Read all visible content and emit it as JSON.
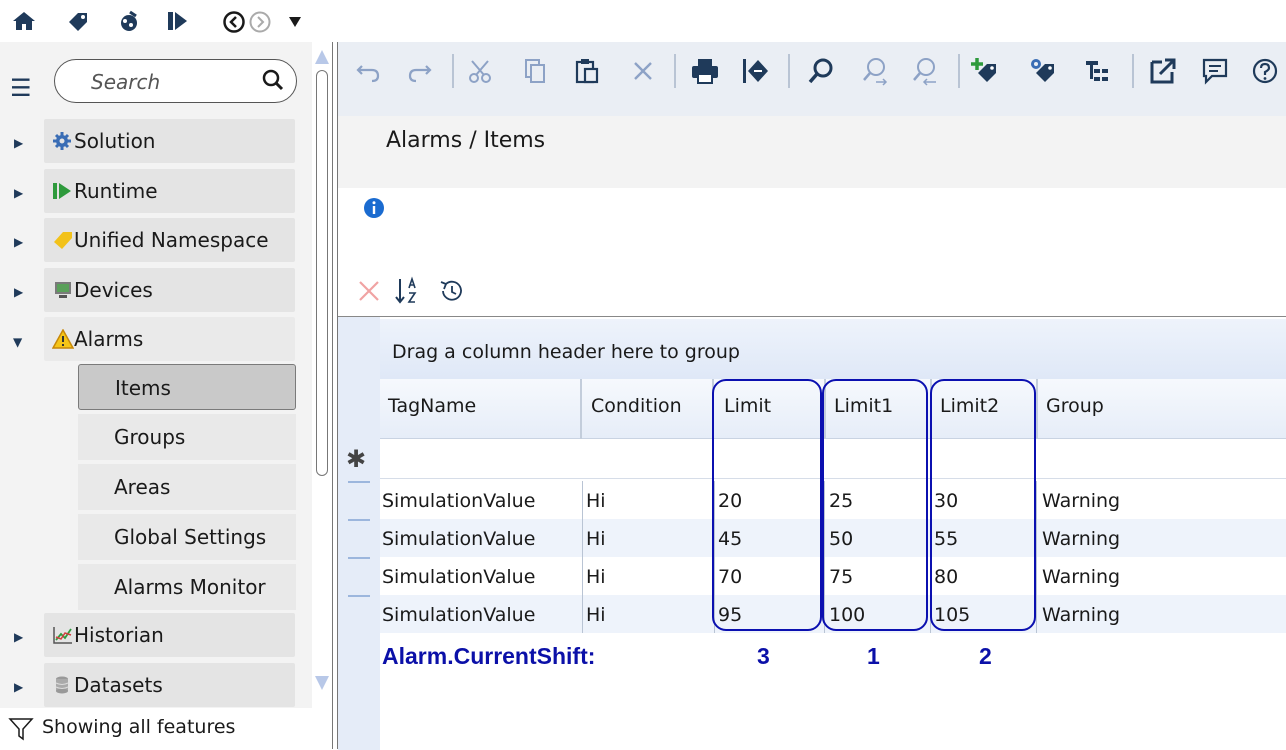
{
  "sidebar": {
    "search_placeholder": "Search",
    "items": [
      {
        "label": "Solution",
        "icon": "gear-icon"
      },
      {
        "label": "Runtime",
        "icon": "runtime-icon"
      },
      {
        "label": "Unified Namespace",
        "icon": "tag-icon"
      },
      {
        "label": "Devices",
        "icon": "devices-icon"
      },
      {
        "label": "Alarms",
        "icon": "warning-icon"
      },
      {
        "label": "Historian",
        "icon": "chart-icon"
      },
      {
        "label": "Datasets",
        "icon": "database-icon"
      }
    ],
    "alarm_children": [
      "Items",
      "Groups",
      "Areas",
      "Global Settings",
      "Alarms Monitor"
    ],
    "selected": "Items",
    "filter_text": "Showing all features"
  },
  "main": {
    "title": "Alarms / Items",
    "grid": {
      "group_hint": "Drag a column header here to group",
      "columns": [
        "TagName",
        "Condition",
        "Limit",
        "Limit1",
        "Limit2",
        "Group"
      ],
      "rows": [
        [
          "SimulationValue",
          "Hi",
          "20",
          "25",
          "30",
          "Warning"
        ],
        [
          "SimulationValue",
          "Hi",
          "45",
          "50",
          "55",
          "Warning"
        ],
        [
          "SimulationValue",
          "Hi",
          "70",
          "75",
          "80",
          "Warning"
        ],
        [
          "SimulationValue",
          "Hi",
          "95",
          "100",
          "105",
          "Warning"
        ]
      ]
    },
    "annotation": {
      "label": "Alarm.CurrentShift:",
      "values": [
        "3",
        "1",
        "2"
      ]
    }
  },
  "colors": {
    "annotation": "#0b10a8",
    "sidebar_bg": "#f3f3f3",
    "toolbar_bg": "#eaeef4"
  }
}
